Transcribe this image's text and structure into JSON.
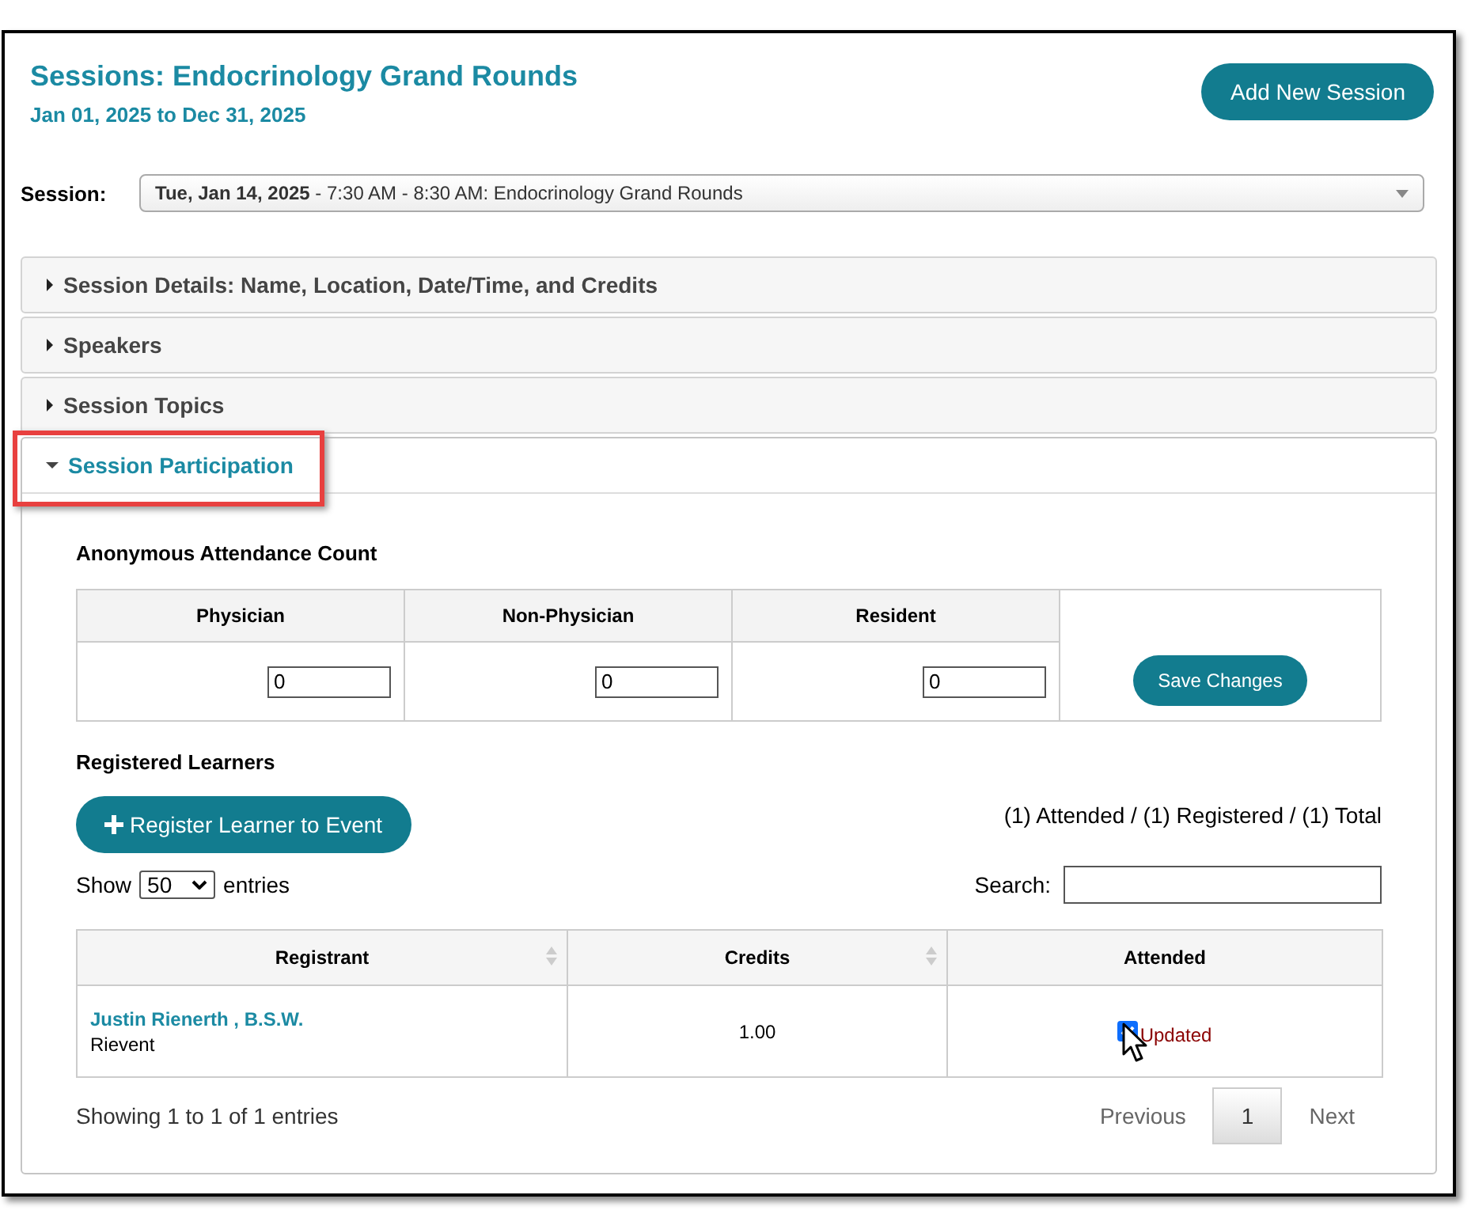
{
  "header": {
    "title": "Sessions: Endocrinology Grand Rounds",
    "date_range": "Jan 01, 2025 to Dec 31, 2025",
    "add_button": "Add New Session"
  },
  "session_select": {
    "label": "Session:",
    "value_bold": "Tue, Jan 14, 2025",
    "value_rest": " - 7:30 AM - 8:30 AM: Endocrinology Grand Rounds"
  },
  "sections": [
    {
      "title": "Session Details: Name, Location, Date/Time, and Credits",
      "expanded": false,
      "highlighted": false
    },
    {
      "title": "Speakers",
      "expanded": false,
      "highlighted": false
    },
    {
      "title": "Session Topics",
      "expanded": false,
      "highlighted": false
    },
    {
      "title": "Session Participation",
      "expanded": true,
      "highlighted": true
    }
  ],
  "participation": {
    "attendance_heading": "Anonymous Attendance Count",
    "attendance_columns": [
      {
        "label": "Physician",
        "value": "0"
      },
      {
        "label": "Non-Physician",
        "value": "0"
      },
      {
        "label": "Resident",
        "value": "0"
      }
    ],
    "save_button": "Save Changes",
    "learners_heading": "Registered Learners",
    "register_button": "Register Learner to Event",
    "summary": "(1) Attended / (1) Registered / (1) Total",
    "show_label": "Show",
    "entries_value": "50",
    "entries_label": "entries",
    "search_label": "Search:",
    "columns": [
      {
        "label": "Registrant",
        "sortable": true
      },
      {
        "label": "Credits",
        "sortable": true
      },
      {
        "label": "Attended",
        "sortable": false
      }
    ],
    "rows": [
      {
        "name": "Justin Rienerth , B.S.W.",
        "org": "Rievent",
        "credits": "1.00",
        "attended": true,
        "status": "Updated"
      }
    ],
    "info": "Showing 1 to 1 of 1 entries",
    "pagination": {
      "previous": "Previous",
      "pages": [
        {
          "label": "1",
          "selected": true
        }
      ],
      "next": "Next"
    }
  }
}
